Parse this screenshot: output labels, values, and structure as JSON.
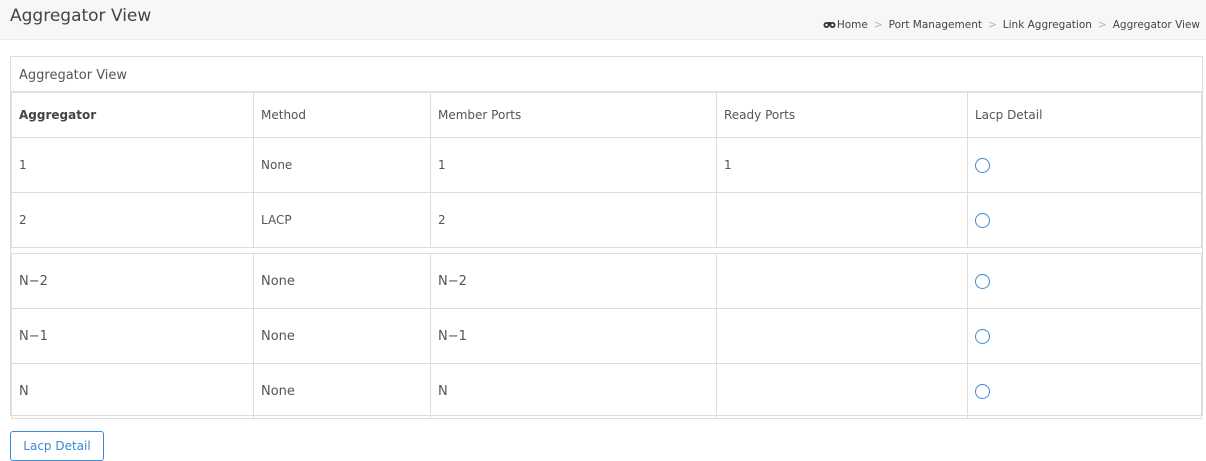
{
  "header": {
    "title": "Aggregator View",
    "breadcrumb": [
      "Home",
      "Port Management",
      "Link Aggregation",
      "Aggregator View"
    ]
  },
  "panel": {
    "title": "Aggregator View",
    "columns": [
      "Aggregator",
      "Method",
      "Member Ports",
      "Ready Ports",
      "Lacp Detail"
    ],
    "rows": [
      {
        "aggregator": "1",
        "method": "None",
        "member_ports": "1",
        "ready_ports": "1"
      },
      {
        "aggregator": "2",
        "method": "LACP",
        "member_ports": "2",
        "ready_ports": ""
      },
      {
        "aggregator": "N−2",
        "method": "None",
        "member_ports": "N−2",
        "ready_ports": ""
      },
      {
        "aggregator": "N−1",
        "method": "None",
        "member_ports": "N−1",
        "ready_ports": ""
      },
      {
        "aggregator": "N",
        "method": "None",
        "member_ports": "N",
        "ready_ports": ""
      }
    ]
  },
  "buttons": {
    "lacp_detail": "Lacp Detail"
  },
  "colors": {
    "accent": "#3a8bd5",
    "border": "#dddddd",
    "topbar": "#f7f7f7"
  },
  "icons": {
    "home": "home-icon",
    "radio": "radio-icon"
  }
}
